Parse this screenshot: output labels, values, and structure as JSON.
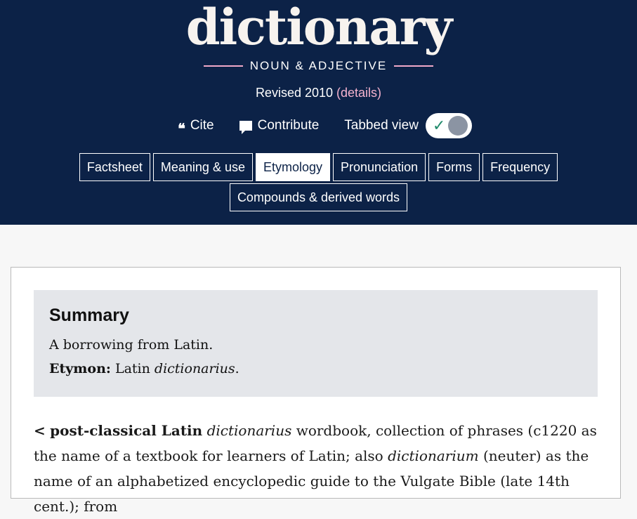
{
  "header": {
    "headword": "dictionary",
    "part_of_speech": "NOUN & ADJECTIVE",
    "revised_text": "Revised 2010",
    "details_link": "(details)"
  },
  "actions": {
    "cite_icon": "quote-icon",
    "cite_label": "Cite",
    "contribute_icon": "speech-bubble-icon",
    "contribute_label": "Contribute",
    "tabbed_view_label": "Tabbed view",
    "tabbed_view_on": true
  },
  "tabs": [
    {
      "label": "Factsheet",
      "active": false
    },
    {
      "label": "Meaning & use",
      "active": false
    },
    {
      "label": "Etymology",
      "active": true
    },
    {
      "label": "Pronunciation",
      "active": false
    },
    {
      "label": "Forms",
      "active": false
    },
    {
      "label": "Frequency",
      "active": false
    },
    {
      "label": "Compounds & derived words",
      "active": false
    }
  ],
  "summary": {
    "heading": "Summary",
    "line1": "A borrowing from Latin.",
    "etymon_label": "Etymon:",
    "etymon_lang": "Latin",
    "etymon_word": "dictionarius",
    "etymon_end": "."
  },
  "etymology": {
    "symbol": "<",
    "source": "post-classical Latin",
    "word1": "dictionarius",
    "text1": "wordbook, collection of phrases (c1220 as the name of a textbook for learners of Latin; also",
    "word2": "dictionarium",
    "text2": "(neuter) as the name of an alphabetized encyclopedic guide to the Vulgate Bible (late 14th cent.); from"
  },
  "colors": {
    "header_bg": "#0c2247",
    "accent_pink": "#f5b3cf",
    "toggle_check": "#1f8a6a"
  }
}
